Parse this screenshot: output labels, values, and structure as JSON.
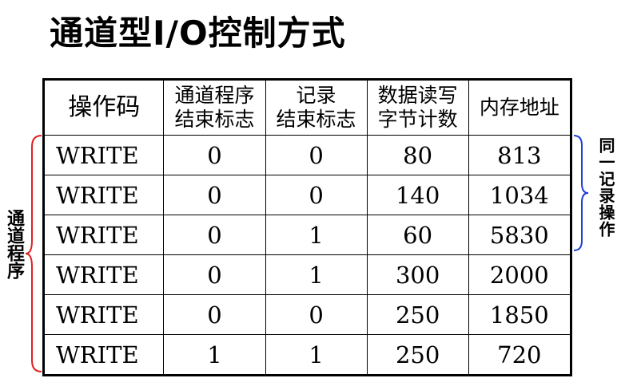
{
  "title": "通道型I/O控制方式",
  "headers": [
    {
      "line1": "操作码",
      "line2": ""
    },
    {
      "line1": "通道程序",
      "line2": "结束标志"
    },
    {
      "line1": "记录",
      "line2": "结束标志"
    },
    {
      "line1": "数据读写",
      "line2": "字节计数"
    },
    {
      "line1": "内存地址",
      "line2": ""
    }
  ],
  "rows": [
    [
      "WRITE",
      "0",
      "0",
      "80",
      "813"
    ],
    [
      "WRITE",
      "0",
      "0",
      "140",
      "1034"
    ],
    [
      "WRITE",
      "0",
      "1",
      "60",
      "5830"
    ],
    [
      "WRITE",
      "0",
      "1",
      "300",
      "2000"
    ],
    [
      "WRITE",
      "0",
      "0",
      "250",
      "1850"
    ],
    [
      "WRITE",
      "1",
      "1",
      "250",
      "720"
    ]
  ],
  "left_annotation": "通道程序",
  "right_annotation": "同一记录操作",
  "colors": {
    "left_brace": "#e02020",
    "right_brace": "#1c3fd8"
  }
}
